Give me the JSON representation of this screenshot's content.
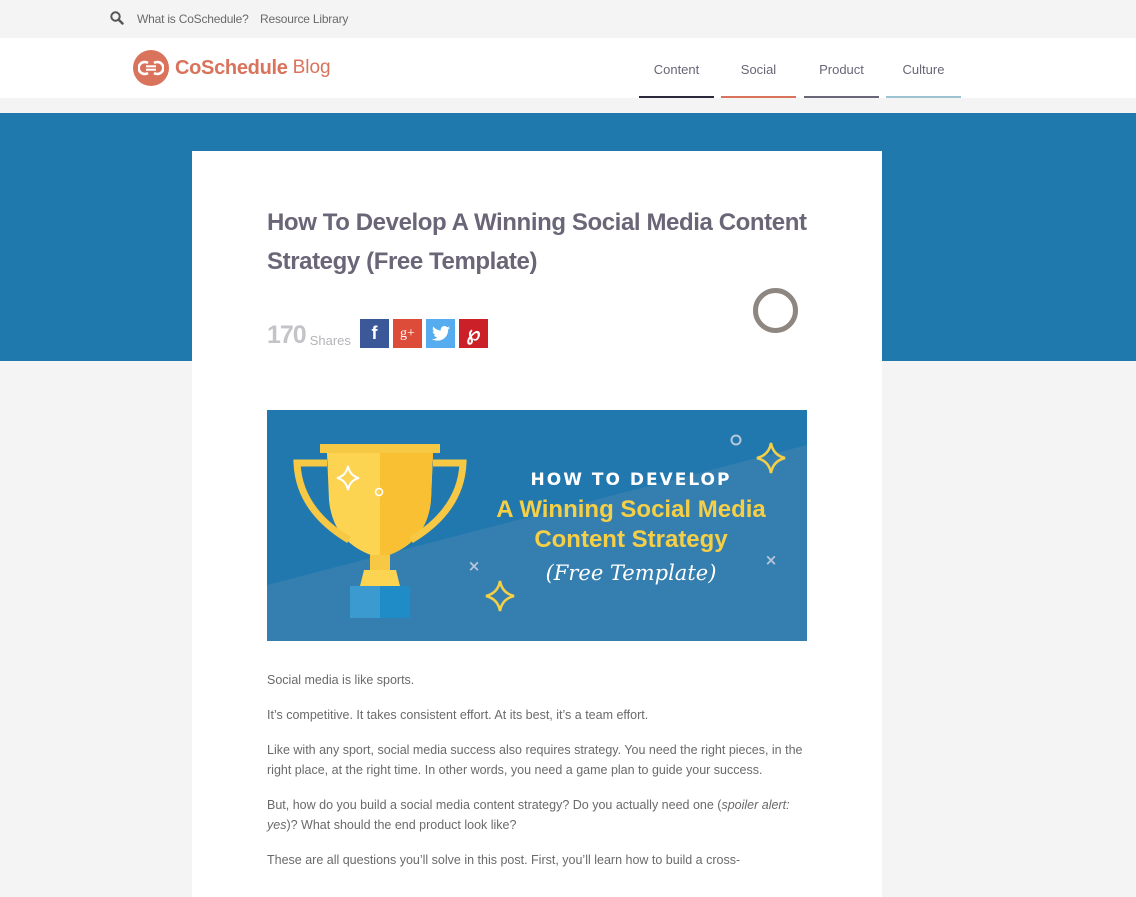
{
  "topbar": {
    "search_icon": "search-icon",
    "links": [
      "What is CoSchedule?",
      "Resource Library"
    ]
  },
  "header": {
    "logo_mark": "CS",
    "logo_name": "CoSchedule",
    "logo_suffix": "Blog",
    "brand_color": "#d9735c",
    "nav": [
      {
        "label": "Content",
        "color": "#2b2a3d"
      },
      {
        "label": "Social",
        "color": "#d9735c"
      },
      {
        "label": "Product",
        "color": "#6a6577"
      },
      {
        "label": "Culture",
        "color": "#9cc3cf"
      }
    ]
  },
  "article": {
    "title": "How To Develop A Winning Social Media Content Strategy (Free Template)",
    "share_count": "170",
    "share_label": "Shares",
    "social": [
      {
        "name": "facebook",
        "glyph": "f",
        "color": "#3b5998"
      },
      {
        "name": "google-plus",
        "glyph": "g+",
        "color": "#dd4b39"
      },
      {
        "name": "twitter",
        "glyph": "t",
        "color": "#55acee"
      },
      {
        "name": "pinterest",
        "glyph": "p",
        "color": "#cb2027"
      }
    ],
    "hero": {
      "line1": "HOW TO DEVELOP",
      "line2": "A Winning Social Media",
      "line3": "Content Strategy",
      "line4": "(Free Template)"
    },
    "paragraphs": [
      "Social media is like sports.",
      "It’s competitive. It takes consistent effort. At its best, it’s a team effort.",
      "Like with any sport, social media success also requires strategy. You need the right pieces, in the right place, at the right time. In other words, you need a game plan to guide your success.",
      "These are all questions you’ll solve in this post. First, you’ll learn how to build a cross-"
    ],
    "p4_before": "But, how do you build a social media content strategy? Do you actually need one (",
    "p4_italic": "spoiler alert: yes",
    "p4_after": ")? What should the end product look like?"
  }
}
